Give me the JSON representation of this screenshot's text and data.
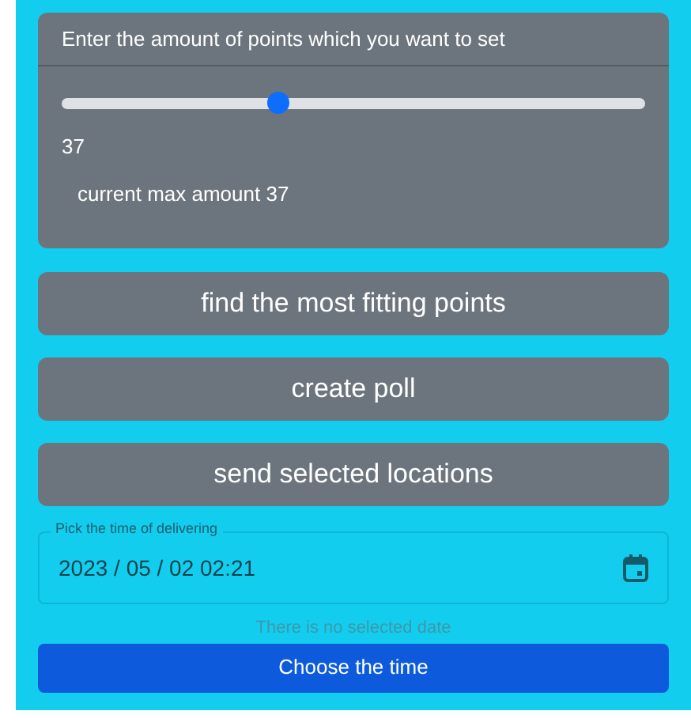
{
  "points_card": {
    "title": "Enter the amount of points which you want to set",
    "slider": {
      "level": 0.37
    },
    "value": "37",
    "max_note": "current max amount 37"
  },
  "actions": [
    "find the most fitting points",
    "create poll",
    "send selected locations"
  ],
  "time_field": {
    "label": "Pick the time of delivering",
    "value": "2023 / 05 / 02 02:21"
  },
  "status": "There is no selected date",
  "submit": "Choose the time"
}
